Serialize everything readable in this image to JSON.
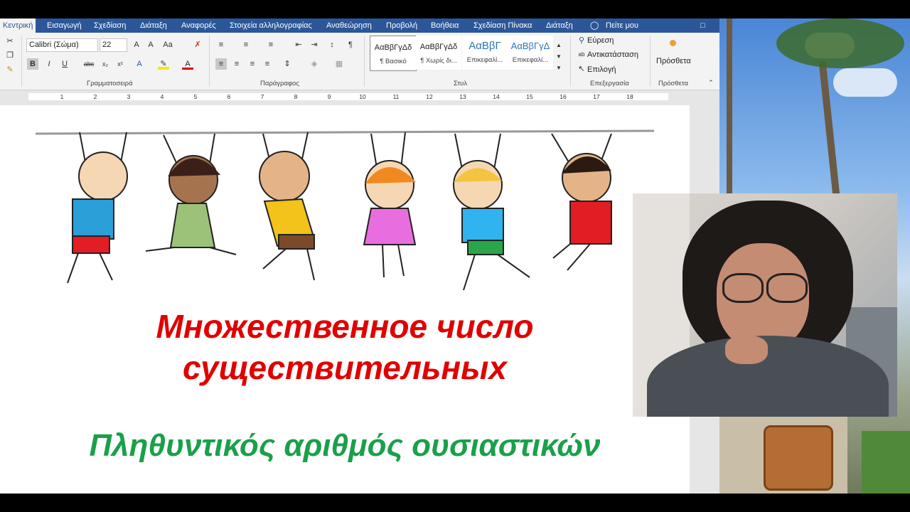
{
  "ribbon": {
    "tabs": [
      "Κεντρική",
      "Εισαγωγή",
      "Σχεδίαση",
      "Διάταξη",
      "Αναφορές",
      "Στοιχεία αλληλογραφίας",
      "Αναθεώρηση",
      "Προβολή",
      "Βοήθεια",
      "Σχεδίαση Πίνακα",
      "Διάταξη"
    ],
    "tell_me": "Πείτε μου",
    "font": {
      "name": "Calibri (Σώμα)",
      "size": "22"
    },
    "groups": {
      "font": "Γραμματοσειρά",
      "paragraph": "Παράγραφος",
      "styles": "Στυλ",
      "editing": "Επεξεργασία",
      "addins": "Πρόσθετα"
    },
    "styles": [
      {
        "preview": "ΑαΒβΓγΔδ",
        "name": "¶ Βασικό"
      },
      {
        "preview": "ΑαΒβΓγΔδ",
        "name": "¶ Χωρίς δι..."
      },
      {
        "preview": "ΑαΒβΓ",
        "name": "Επικεφαλί..."
      },
      {
        "preview": "ΑαΒβΓγΔ",
        "name": "Επικεφαλί..."
      }
    ],
    "editing": {
      "find": "Εύρεση",
      "replace": "Αντικατάσταση",
      "select": "Επιλογή"
    },
    "addins_button": "Πρόσθετα"
  },
  "ruler": [
    "1",
    "2",
    "3",
    "4",
    "5",
    "6",
    "7",
    "8",
    "9",
    "10",
    "11",
    "12",
    "13",
    "14",
    "15",
    "16",
    "17",
    "18"
  ],
  "document": {
    "title_ru_line1": "Множественное число",
    "title_ru_line2": "существительных",
    "title_gr": "Πληθυντικός αριθμός ουσιαστικών"
  },
  "colors": {
    "ribbon_blue": "#2b579a",
    "russian_title": "#e00000",
    "greek_title": "#1aa04a"
  },
  "icons": [
    "cut-icon",
    "copy-icon",
    "format-painter-icon",
    "bold-icon",
    "italic-icon",
    "underline-icon",
    "bullets-icon",
    "numbering-icon",
    "search-icon",
    "lightbulb-icon",
    "comment-icon"
  ]
}
